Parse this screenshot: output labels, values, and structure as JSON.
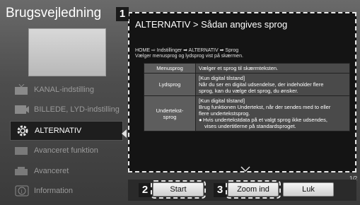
{
  "app": {
    "title": "Brugsvejledning"
  },
  "sidebar": {
    "items": [
      {
        "label": "KANAL-indstilling",
        "icon": "tv-antenna-icon",
        "active": false
      },
      {
        "label": "BILLEDE, LYD-indstilling",
        "icon": "picture-sound-icon",
        "active": false
      },
      {
        "label": "ALTERNATIV",
        "icon": "gear-icon",
        "active": true
      },
      {
        "label": "Avanceret funktion",
        "icon": "advanced-function-icon",
        "active": false
      },
      {
        "label": "Avanceret",
        "icon": "advanced-icon",
        "active": false
      },
      {
        "label": "Information",
        "icon": "info-icon",
        "active": false
      }
    ]
  },
  "dialog": {
    "title": "ALTERNATIV > Sådan angives sprog",
    "path": "HOME ⇨ Indstillinger ➡ ALTERNATIV ➡ Sprog",
    "description": "Vælger menusprog og lydsprog vist på skærmen.",
    "rows": [
      {
        "key": "Menusprog",
        "lines": [
          "Vælger et sprog til skærmteksten."
        ]
      },
      {
        "key": "Lydsprog",
        "lines": [
          "[Kun digital tilstand]",
          "Når du ser en digital udsendelse, der indeholder flere",
          "sprog, kan du vælge det sprog, du ønsker."
        ]
      },
      {
        "key": "Undertekst-\nsprog",
        "lines": [
          "[Kun digital tilstand]",
          "Brug funktionen Undertekst, når der sendes med to eller",
          "flere undertekstsprog."
        ],
        "note_lines": [
          "Hvis undertekstdata på et valgt sprog ikke udsendes,",
          "vises undertitlerne på standardsproget."
        ]
      }
    ],
    "page_indicator": "1/2"
  },
  "markers": {
    "m1": "1",
    "m2": "2",
    "m3": "3"
  },
  "buttons": {
    "start": "Start",
    "zoom": "Zoom ind",
    "close": "Luk"
  }
}
